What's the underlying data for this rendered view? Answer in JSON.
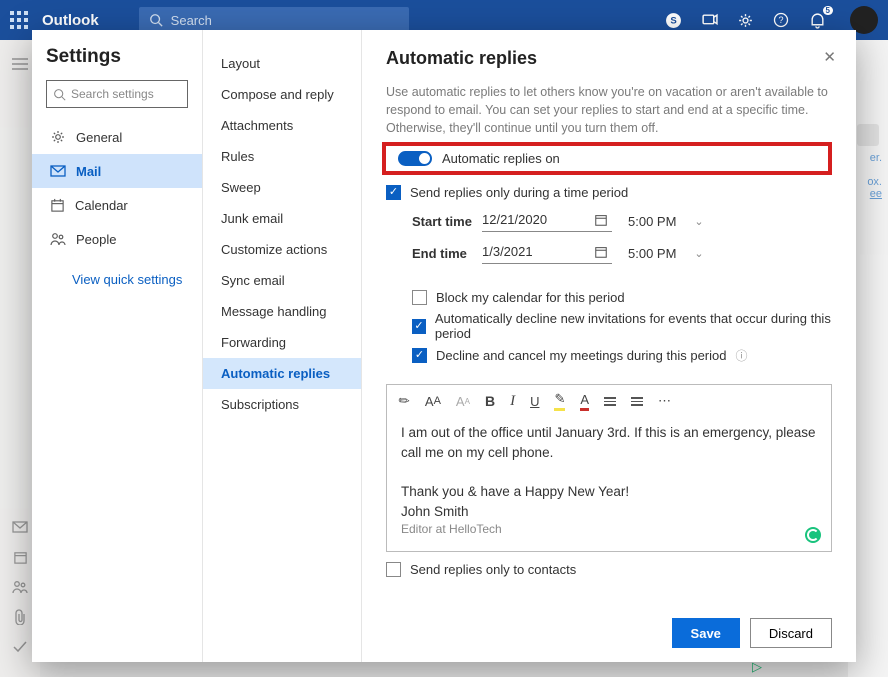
{
  "header": {
    "brand": "Outlook",
    "search_placeholder": "Search",
    "notif_count": "5"
  },
  "dialog": {
    "title": "Settings",
    "search_placeholder": "Search settings",
    "nav": {
      "general": "General",
      "mail": "Mail",
      "calendar": "Calendar",
      "people": "People",
      "quick": "View quick settings"
    },
    "section": {
      "layout": "Layout",
      "compose": "Compose and reply",
      "attachments": "Attachments",
      "rules": "Rules",
      "sweep": "Sweep",
      "junk": "Junk email",
      "customize": "Customize actions",
      "sync": "Sync email",
      "msghandling": "Message handling",
      "forwarding": "Forwarding",
      "autoreplies": "Automatic replies",
      "subscriptions": "Subscriptions"
    }
  },
  "pane": {
    "title": "Automatic replies",
    "help": "Use automatic replies to let others know you're on vacation or aren't available to respond to email. You can set your replies to start and end at a specific time. Otherwise, they'll continue until you turn them off.",
    "toggle_label": "Automatic replies on",
    "period_label": "Send replies only during a time period",
    "start_label": "Start time",
    "start_date": "12/21/2020",
    "start_time": "5:00 PM",
    "end_label": "End time",
    "end_date": "1/3/2021",
    "end_time": "5:00 PM",
    "block_label": "Block my calendar for this period",
    "decline_new_label": "Automatically decline new invitations for events that occur during this period",
    "decline_cancel_label": "Decline and cancel my meetings during this period",
    "msg_line1": "I am out of the office until January 3rd. If this is an emergency, please call me on my cell phone.",
    "msg_line2": "Thank you & have a Happy New Year!",
    "msg_line3": "John Smith",
    "msg_sig": "Editor at HelloTech",
    "contacts_label": "Send replies only to contacts",
    "save": "Save",
    "discard": "Discard"
  },
  "bg": {
    "snip1": "er.",
    "snip2": "ox.",
    "snip3": "ee"
  }
}
